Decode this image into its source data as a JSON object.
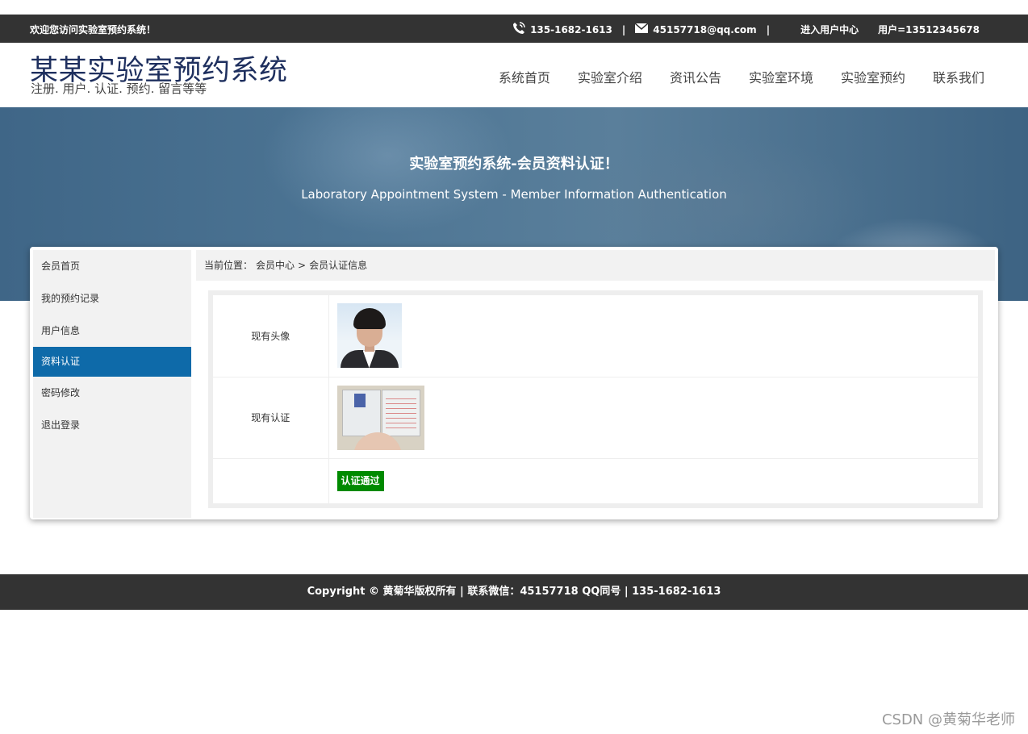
{
  "topbar": {
    "welcome": "欢迎您访问实验室预约系统！",
    "phone": "135-1682-1613",
    "separator": "|",
    "email": "45157718@qq.com",
    "user_center": "进入用户中心",
    "user": "用户=13512345678"
  },
  "header": {
    "logo_title": "某某实验室预约系统",
    "logo_subtitle": "注册. 用户. 认证. 预约. 留言等等",
    "nav": [
      "系统首页",
      "实验室介绍",
      "资讯公告",
      "实验室环境",
      "实验室预约",
      "联系我们"
    ]
  },
  "banner": {
    "title": "实验室预约系统-会员资料认证！",
    "subtitle": "Laboratory Appointment System - Member Information Authentication"
  },
  "sidebar": {
    "items": [
      {
        "label": "会员首页",
        "active": false
      },
      {
        "label": "我的预约记录",
        "active": false
      },
      {
        "label": "用户信息",
        "active": false
      },
      {
        "label": "资料认证",
        "active": true
      },
      {
        "label": "密码修改",
        "active": false
      },
      {
        "label": "退出登录",
        "active": false
      }
    ]
  },
  "breadcrumb": {
    "prefix": "当前位置：",
    "level1": "会员中心",
    "sep": ">",
    "level2": "会员认证信息"
  },
  "verification": {
    "avatar_label": "现有头像",
    "cert_label": "现有认证",
    "status_button": "认证通过"
  },
  "footer": {
    "text": "Copyright © 黄菊华版权所有 | 联系微信：45157718 QQ同号 | 135-1682-1613"
  },
  "watermark": "CSDN @黄菊华老师",
  "colors": {
    "topbar_bg": "#333333",
    "logo": "#1e2f5e",
    "sidebar_active": "#0e6aa9",
    "status_button": "#008a00"
  }
}
